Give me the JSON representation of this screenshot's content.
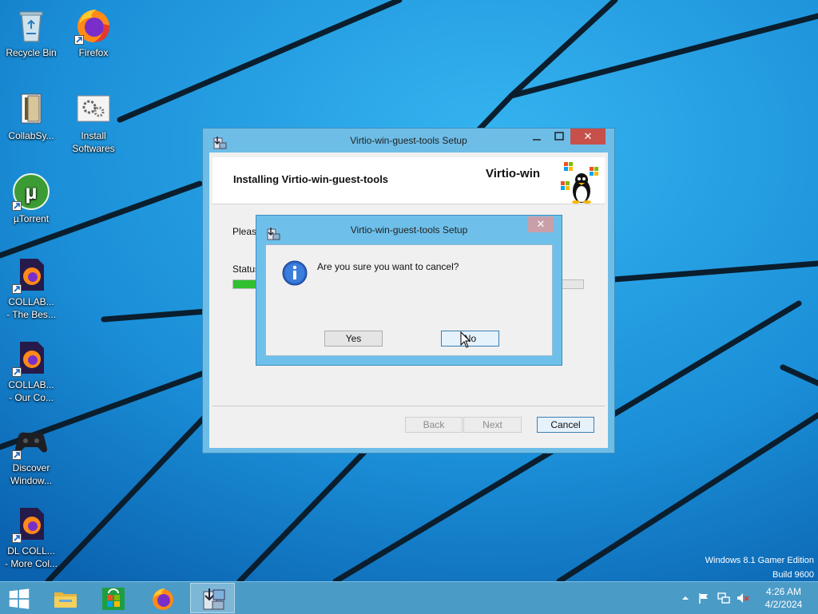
{
  "desktop": {
    "icons": [
      {
        "label": "Recycle Bin"
      },
      {
        "label": "Firefox"
      },
      {
        "label": "CollabSy..."
      },
      {
        "label": "Install\nSoftwares"
      },
      {
        "label": "µTorrent"
      },
      {
        "label": "COLLAB...\n- The Bes..."
      },
      {
        "label": "COLLAB...\n- Our Co..."
      },
      {
        "label": "Discover\nWindow..."
      },
      {
        "label": "DL COLL...\n- More Col..."
      }
    ],
    "watermark": {
      "line1": "Windows 8.1 Gamer Edition",
      "line2": "Build 9600"
    }
  },
  "setup_window": {
    "title": "Virtio-win-guest-tools Setup",
    "header_title": "Installing Virtio-win-guest-tools",
    "brand": "Virtio-win",
    "please_wait_text": "Please",
    "status_label": "Status",
    "progress": 0.1,
    "back_label": "Back",
    "next_label": "Next",
    "cancel_label": "Cancel"
  },
  "dialog": {
    "title": "Virtio-win-guest-tools Setup",
    "message": "Are you sure you want to cancel?",
    "yes_label": "Yes",
    "no_label": "No"
  },
  "taskbar": {
    "time": "4:26 AM",
    "date": "4/2/2024"
  },
  "colors": {
    "wallpaper": "#1a8fd6",
    "window_frame": "#6dbde7",
    "close_red": "#c7504b",
    "progress_green": "#2fbf2f",
    "taskbar": "#4b9bc7"
  }
}
